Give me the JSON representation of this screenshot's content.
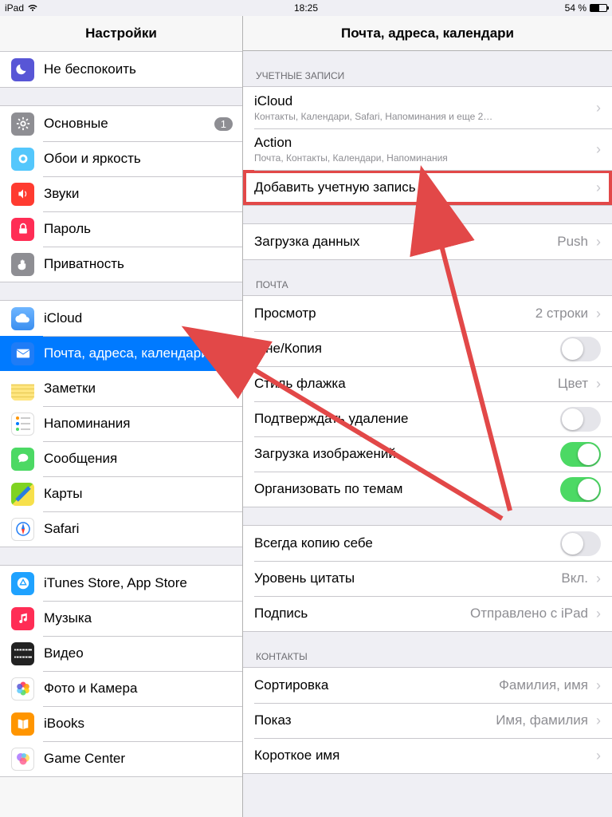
{
  "status": {
    "device": "iPad",
    "time": "18:25",
    "battery_pct": "54 %"
  },
  "sidebar": {
    "title": "Настройки",
    "groups": [
      {
        "items": [
          {
            "label": "Не беспокоить",
            "icon": "moon",
            "bg": "#5856d6"
          },
          {
            "label": "Основные",
            "icon": "gear",
            "bg": "#8e8e93",
            "badge": "1"
          },
          {
            "label": "Обои и яркость",
            "icon": "wallpaper",
            "bg": "#54c7fc"
          },
          {
            "label": "Звуки",
            "icon": "speaker",
            "bg": "#ff3b30"
          },
          {
            "label": "Пароль",
            "icon": "lock",
            "bg": "#ff2d55"
          },
          {
            "label": "Приватность",
            "icon": "hand",
            "bg": "#8e8e93"
          }
        ]
      },
      {
        "items": [
          {
            "label": "iCloud",
            "icon": "cloud",
            "bg": "#ffffff",
            "boxStyle": "cloud"
          },
          {
            "label": "Почта, адреса, календари",
            "icon": "mail",
            "bg": "#1f7cf6",
            "selected": true
          },
          {
            "label": "Заметки",
            "icon": "notes",
            "bg": "#ffcc00"
          },
          {
            "label": "Напоминания",
            "icon": "reminders",
            "bg": "#ffffff",
            "boxStyle": "reminders"
          },
          {
            "label": "Сообщения",
            "icon": "messages",
            "bg": "#4cd964"
          },
          {
            "label": "Карты",
            "icon": "maps",
            "bg": "#54c7fc",
            "boxStyle": "maps"
          },
          {
            "label": "Safari",
            "icon": "compass",
            "bg": "#ffffff",
            "boxStyle": "safari"
          }
        ]
      },
      {
        "items": [
          {
            "label": "iTunes Store, App Store",
            "icon": "appstore",
            "bg": "#1fa2ff"
          },
          {
            "label": "Музыка",
            "icon": "music",
            "bg": "#ff2d55"
          },
          {
            "label": "Видео",
            "icon": "video",
            "bg": "#ffffff",
            "boxStyle": "video"
          },
          {
            "label": "Фото и Камера",
            "icon": "photos",
            "bg": "#ffffff",
            "boxStyle": "photos"
          },
          {
            "label": "iBooks",
            "icon": "ibooks",
            "bg": "#ff9500"
          },
          {
            "label": "Game Center",
            "icon": "gamecenter",
            "bg": "#ffffff",
            "boxStyle": "gamecenter"
          }
        ]
      }
    ]
  },
  "detail": {
    "title": "Почта, адреса, календари",
    "sections": {
      "accounts_header": "УЧЕТНЫЕ ЗАПИСИ",
      "accounts": [
        {
          "title": "iCloud",
          "sub": "Контакты, Календари, Safari, Напоминания и еще 2…"
        },
        {
          "title": "Action",
          "sub": "Почта, Контакты, Календари, Напоминания"
        },
        {
          "title": "Добавить учетную запись",
          "highlight": true
        }
      ],
      "fetch": {
        "title": "Загрузка данных",
        "value": "Push"
      },
      "mail_header": "ПОЧТА",
      "mail": [
        {
          "title": "Просмотр",
          "value": "2 строки",
          "type": "value"
        },
        {
          "title": "Мне/Копия",
          "type": "switch",
          "on": false
        },
        {
          "title": "Стиль флажка",
          "value": "Цвет",
          "type": "value"
        },
        {
          "title": "Подтверждать удаление",
          "type": "switch",
          "on": false
        },
        {
          "title": "Загрузка изображений",
          "type": "switch",
          "on": true
        },
        {
          "title": "Организовать по темам",
          "type": "switch",
          "on": true
        }
      ],
      "mail2": [
        {
          "title": "Всегда копию себе",
          "type": "switch",
          "on": false
        },
        {
          "title": "Уровень цитаты",
          "value": "Вкл.",
          "type": "value"
        },
        {
          "title": "Подпись",
          "value": "Отправлено с iPad",
          "type": "value"
        }
      ],
      "contacts_header": "КОНТАКТЫ",
      "contacts": [
        {
          "title": "Сортировка",
          "value": "Фамилия, имя",
          "type": "value"
        },
        {
          "title": "Показ",
          "value": "Имя, фамилия",
          "type": "value"
        },
        {
          "title": "Короткое имя",
          "type": "value",
          "value": ""
        }
      ]
    }
  },
  "annotations": {
    "highlight_color": "#e24848"
  }
}
